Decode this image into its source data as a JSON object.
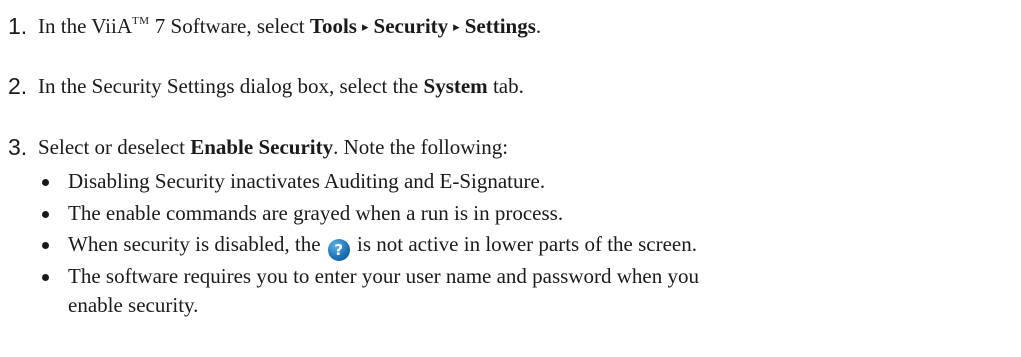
{
  "steps": [
    {
      "number": "1.",
      "prefix": "In the ViiA",
      "trademark": "TM",
      "middle": " 7 Software, select ",
      "menu_path": [
        "Tools",
        "Security",
        "Settings"
      ],
      "suffix": "."
    },
    {
      "number": "2.",
      "prefix": "In the Security Settings dialog box, select the ",
      "bold": "System",
      "suffix": " tab."
    },
    {
      "number": "3.",
      "prefix": "Select or deselect ",
      "bold": "Enable Security",
      "suffix": ". Note the following:"
    }
  ],
  "bullets": [
    "Disabling Security inactivates Auditing and E-Signature.",
    "The enable commands are grayed when a run is in process.",
    {
      "before_icon": "When security is disabled, the ",
      "icon": "help-icon",
      "icon_glyph": "?",
      "after_icon": " is not active in lower parts of the screen."
    },
    {
      "line1": "The software requires you to enter your user name and password when you",
      "line2": "enable security."
    }
  ],
  "separator_glyph": "▸"
}
